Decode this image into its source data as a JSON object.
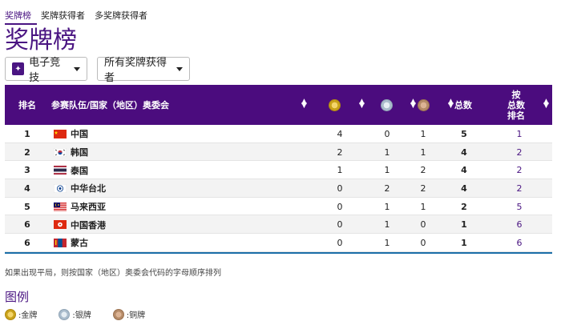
{
  "tabs": [
    "奖牌榜",
    "奖牌获得者",
    "多奖牌获得者"
  ],
  "page_title": "奖牌榜",
  "filters": {
    "discipline": "电子竞技",
    "winners": "所有奖牌获得者"
  },
  "table": {
    "headers": {
      "rank": "排名",
      "country": "参赛队伍/国家（地区）奥委会",
      "total": "总数",
      "total_rank": "按\n总数\n排名"
    },
    "rows": [
      {
        "rank": "1",
        "name": "中国",
        "gold": "4",
        "silver": "0",
        "bronze": "1",
        "total": "5",
        "total_rank": "1",
        "flag": "cn"
      },
      {
        "rank": "2",
        "name": "韩国",
        "gold": "2",
        "silver": "1",
        "bronze": "1",
        "total": "4",
        "total_rank": "2",
        "flag": "kr"
      },
      {
        "rank": "3",
        "name": "泰国",
        "gold": "1",
        "silver": "1",
        "bronze": "2",
        "total": "4",
        "total_rank": "2",
        "flag": "th"
      },
      {
        "rank": "4",
        "name": "中华台北",
        "gold": "0",
        "silver": "2",
        "bronze": "2",
        "total": "4",
        "total_rank": "2",
        "flag": "tpe"
      },
      {
        "rank": "5",
        "name": "马来西亚",
        "gold": "0",
        "silver": "1",
        "bronze": "1",
        "total": "2",
        "total_rank": "5",
        "flag": "my"
      },
      {
        "rank": "6",
        "name": "中国香港",
        "gold": "0",
        "silver": "1",
        "bronze": "0",
        "total": "1",
        "total_rank": "6",
        "flag": "hk"
      },
      {
        "rank": "6",
        "name": "蒙古",
        "gold": "0",
        "silver": "1",
        "bronze": "0",
        "total": "1",
        "total_rank": "6",
        "flag": "mn"
      }
    ]
  },
  "note": "如果出现平局，则按国家（地区）奥委会代码的字母顺序排列",
  "legend": {
    "title": "图例",
    "gold": ":金牌",
    "silver": ":银牌",
    "bronze": ":铜牌"
  },
  "colors": {
    "brand": "#4a1582",
    "header_bg": "#4b0c7e",
    "gold": "#c9a21a",
    "silver": "#aabccc",
    "bronze": "#b58b68"
  }
}
